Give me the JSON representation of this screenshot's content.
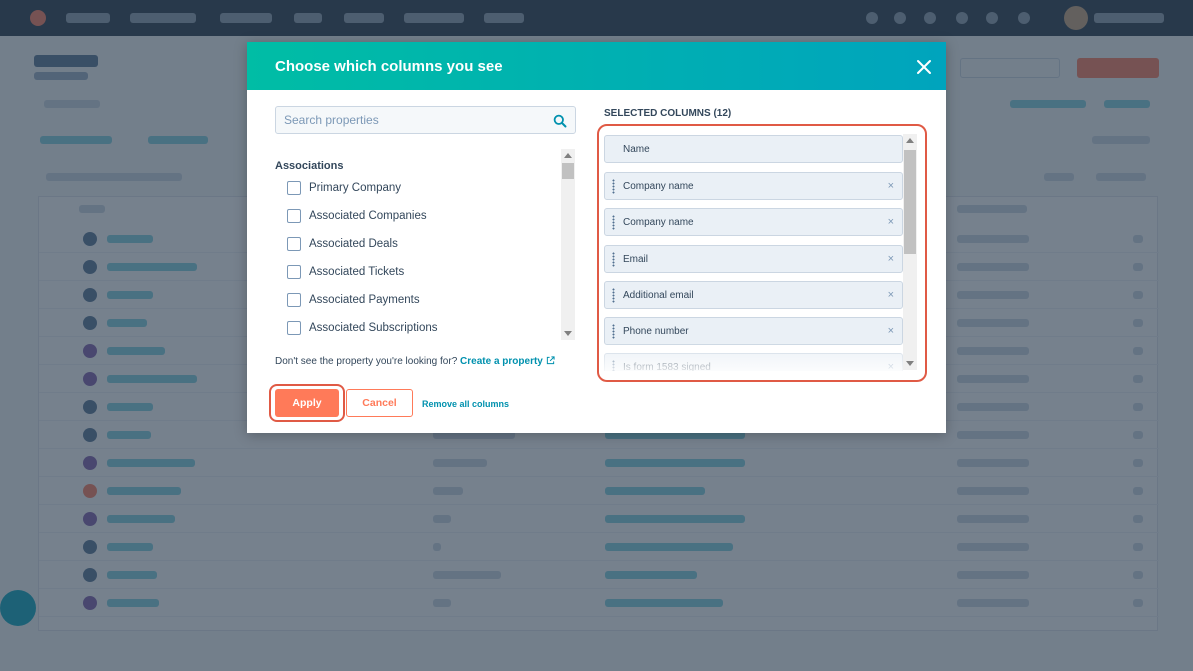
{
  "modal": {
    "title": "Choose which columns you see",
    "close_icon": "close-icon",
    "search_placeholder": "Search properties",
    "search_value": "",
    "search_icon": "search-icon",
    "associations_heading": "Associations",
    "associations": [
      {
        "label": "Primary Company",
        "checked": false
      },
      {
        "label": "Associated Companies",
        "checked": false
      },
      {
        "label": "Associated Deals",
        "checked": false
      },
      {
        "label": "Associated Tickets",
        "checked": false
      },
      {
        "label": "Associated Payments",
        "checked": false
      },
      {
        "label": "Associated Subscriptions",
        "checked": false
      }
    ],
    "dont_see_text": "Don't see the property you're looking for?",
    "create_property_link": "Create a property",
    "apply_label": "Apply",
    "cancel_label": "Cancel",
    "remove_all_label": "Remove all columns",
    "selected_heading": "SELECTED COLUMNS (12)",
    "selected_columns": [
      {
        "label": "Name",
        "removable": false
      },
      {
        "label": "Company name",
        "removable": true
      },
      {
        "label": "Company name",
        "removable": true
      },
      {
        "label": "Email",
        "removable": true
      },
      {
        "label": "Additional email",
        "removable": true
      },
      {
        "label": "Phone number",
        "removable": true
      },
      {
        "label": "Is form 1583 signed",
        "removable": true
      }
    ],
    "remove_glyph": "×"
  },
  "colors": {
    "header_gradient_start": "#00bda5",
    "header_gradient_end": "#00a4bd",
    "primary_button": "#ff7a59",
    "link": "#0091ae",
    "highlight_annotation": "#e05a45"
  }
}
